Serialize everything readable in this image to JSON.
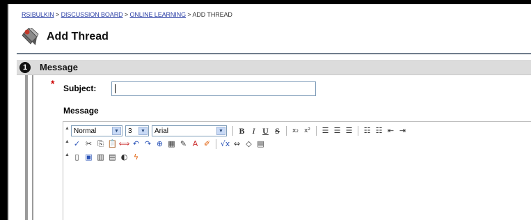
{
  "breadcrumb": {
    "items": [
      "RSIBULKIN",
      "DISCUSSION BOARD",
      "ONLINE LEARNING"
    ],
    "separator": ">",
    "current": "ADD THREAD"
  },
  "page": {
    "title": "Add Thread"
  },
  "step": {
    "number": "1",
    "label": "Message"
  },
  "form": {
    "required_marker": "*",
    "subject_label": "Subject:",
    "subject_value": "",
    "message_label": "Message"
  },
  "toolbar": {
    "format_value": "Normal",
    "size_value": "3",
    "font_value": "Arial",
    "bold": "B",
    "italic": "I",
    "underline": "U",
    "strike": "S"
  },
  "colors": {
    "link": "#2b3fa6",
    "required": "#cc0000",
    "step_bar": "#dcdcdc"
  }
}
